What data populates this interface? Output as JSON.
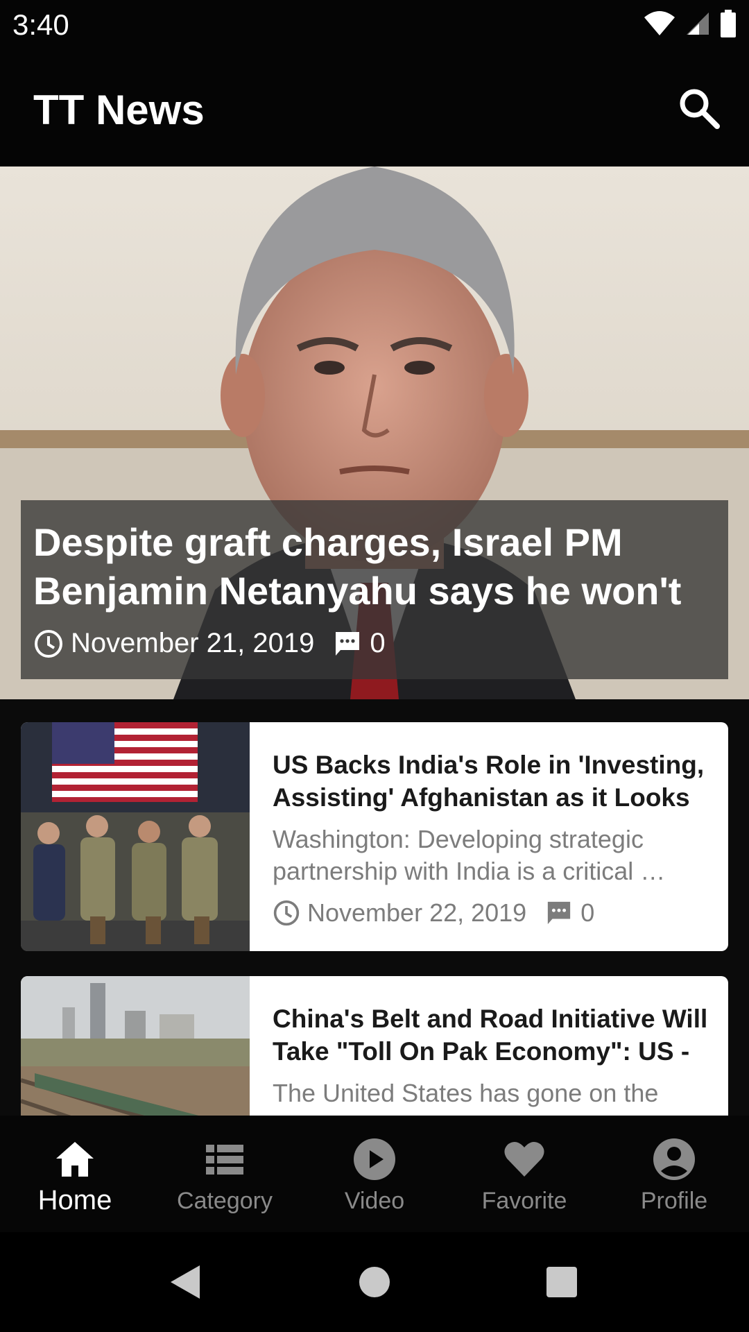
{
  "status_bar": {
    "time": "3:40"
  },
  "app_bar": {
    "title": "TT News"
  },
  "hero": {
    "title": "Despite graft charges, Israel PM Benjamin Netanyahu says he won't",
    "date": "November 21, 2019",
    "comments": "0"
  },
  "articles": [
    {
      "title": "US Backs India's Role in 'Investing, Assisting' Afghanistan as it Looks",
      "excerpt": "Washington: Developing strategic partnership with India is a critical …",
      "date": "November 22, 2019",
      "comments": "0"
    },
    {
      "title": "China's Belt and Road Initiative Will Take \"Toll On Pak Economy\": US -",
      "excerpt": "The United States has gone on the offensive against China's Belt and",
      "date": "",
      "comments": ""
    }
  ],
  "bottom_nav": [
    {
      "label": "Home",
      "icon": "home-icon",
      "active": true
    },
    {
      "label": "Category",
      "icon": "list-icon",
      "active": false
    },
    {
      "label": "Video",
      "icon": "play-icon",
      "active": false
    },
    {
      "label": "Favorite",
      "icon": "heart-icon",
      "active": false
    },
    {
      "label": "Profile",
      "icon": "account-icon",
      "active": false
    }
  ],
  "colors": {
    "background": "#0b0b0b",
    "card": "#ffffff",
    "nav_active": "#ffffff",
    "nav_inactive": "#8a8a8a",
    "muted_text": "#7c7c7c"
  }
}
